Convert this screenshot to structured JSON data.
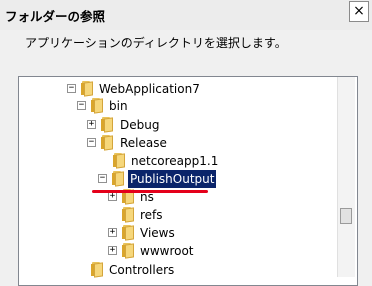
{
  "window": {
    "title": "フォルダーの参照",
    "close_label": "×"
  },
  "dialog": {
    "instruction": "アプリケーションのディレクトリを選択します。"
  },
  "tree": {
    "items": [
      {
        "label": "WebApplication7",
        "expander": "−"
      },
      {
        "label": "bin",
        "expander": "−"
      },
      {
        "label": "Debug",
        "expander": "+"
      },
      {
        "label": "Release",
        "expander": "−"
      },
      {
        "label": "netcoreapp1.1",
        "expander": ""
      },
      {
        "label": "PublishOutput",
        "expander": "−",
        "selected": true
      },
      {
        "label": "ns",
        "expander": "+"
      },
      {
        "label": "refs",
        "expander": ""
      },
      {
        "label": "Views",
        "expander": "+"
      },
      {
        "label": "wwwroot",
        "expander": "+"
      },
      {
        "label": "Controllers",
        "expander": ""
      }
    ]
  },
  "annotation": {
    "color": "#e4001a"
  },
  "colors": {
    "selection": "#0a246a",
    "folder": "#f6d77b"
  }
}
